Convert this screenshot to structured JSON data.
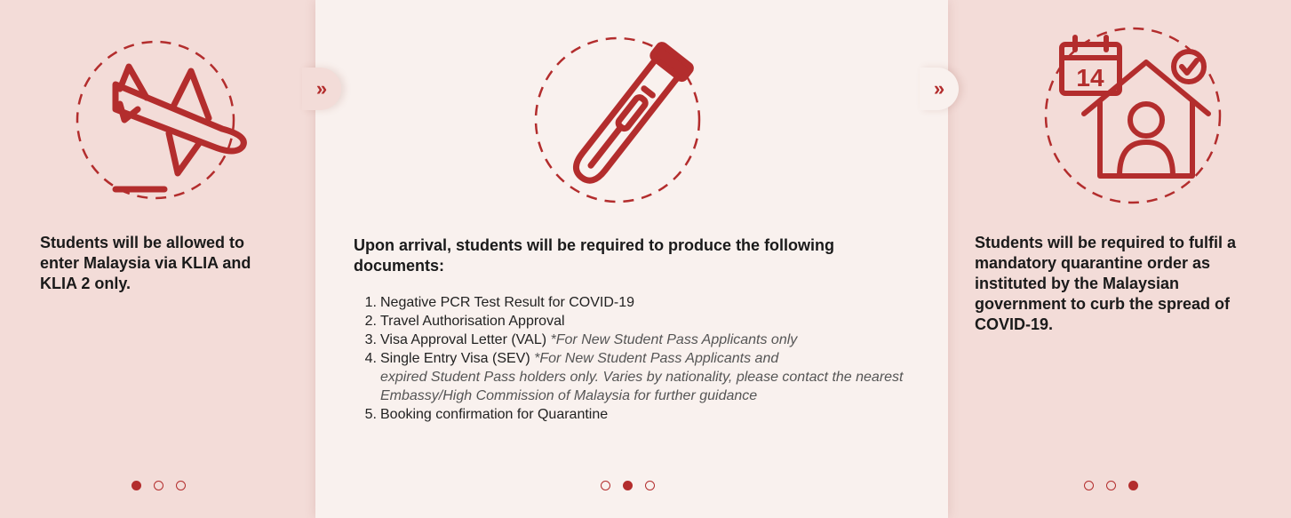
{
  "steps": [
    {
      "icon": "airplane-landing-icon",
      "text": "Students will be allowed to enter Malaysia via KLIA and KLIA 2 only.",
      "active_dot": 1
    },
    {
      "icon": "pcr-swab-tube-icon",
      "intro": "Upon arrival, students will be required to produce the following documents:",
      "items": [
        {
          "num": "1.",
          "text": "Negative PCR Test Result for COVID-19",
          "note": ""
        },
        {
          "num": "2.",
          "text": "Travel Authorisation Approval",
          "note": ""
        },
        {
          "num": "3.",
          "text": "Visa Approval Letter (VAL)",
          "note": "*For New Student Pass Applicants only"
        },
        {
          "num": "4.",
          "text": "Single Entry Visa (SEV)",
          "note": "*For New Student Pass Applicants and",
          "note_cont": "expired Student Pass holders only. Varies by nationality, please contact the nearest Embassy/High Commission of Malaysia for further guidance"
        },
        {
          "num": "5.",
          "text": "Booking confirmation for Quarantine",
          "note": ""
        }
      ],
      "active_dot": 2
    },
    {
      "icon": "home-quarantine-calendar-icon",
      "calendar_number": "14",
      "text": "Students will be required to fulfil a mandatory quarantine order as instituted by the Malaysian government to curb the spread of COVID-19.",
      "active_dot": 3
    }
  ],
  "chevron_glyph": "»",
  "colors": {
    "accent": "#b32d2d",
    "panel_side": "#f3dcd8",
    "panel_center": "#f9f1ee"
  }
}
